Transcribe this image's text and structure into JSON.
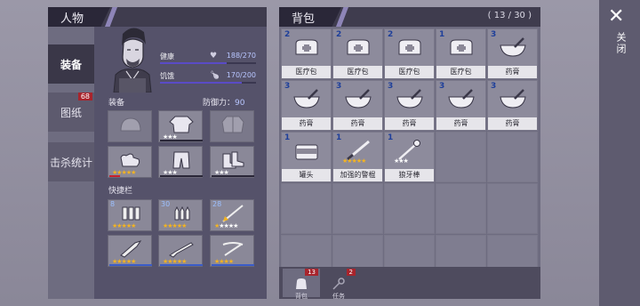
{
  "character_panel": {
    "title": "人物",
    "tabs": [
      {
        "label": "装备",
        "active": true
      },
      {
        "label": "图纸",
        "badge": "68"
      },
      {
        "label": "击杀统计"
      }
    ],
    "stats": {
      "health": {
        "label": "健康",
        "value": "188/270",
        "fraction": 0.696
      },
      "hunger": {
        "label": "饥饿",
        "value": "170/200",
        "fraction": 0.85
      }
    },
    "equipment_label": "装备",
    "defense_label": "防御力：",
    "defense_value": "90",
    "quickbar_label": "快捷栏",
    "equipment": [
      {
        "name": "helmet",
        "stars": 0
      },
      {
        "name": "shirt",
        "stars": 3
      },
      {
        "name": "jacket",
        "stars": 0
      },
      {
        "name": "gloves",
        "stars": 5
      },
      {
        "name": "pants",
        "stars": 3
      },
      {
        "name": "boots",
        "stars": 3
      }
    ],
    "quickbar": [
      {
        "name": "shells",
        "qty": "8",
        "stars": 5
      },
      {
        "name": "bullets",
        "qty": "30",
        "stars": 5
      },
      {
        "name": "arrows",
        "qty": "28",
        "stars": 5
      },
      {
        "name": "knife",
        "stars": 5
      },
      {
        "name": "rifle",
        "stars": 5
      },
      {
        "name": "crossbow",
        "stars": 4
      }
    ]
  },
  "backpack": {
    "title": "背包",
    "count": "( 13 / 30 )",
    "items": [
      {
        "count": "2",
        "label": "医疗包",
        "icon": "medkit"
      },
      {
        "count": "2",
        "label": "医疗包",
        "icon": "medkit"
      },
      {
        "count": "2",
        "label": "医疗包",
        "icon": "medkit"
      },
      {
        "count": "1",
        "label": "医疗包",
        "icon": "medkit"
      },
      {
        "count": "3",
        "label": "药膏",
        "icon": "mortar"
      },
      {
        "count": "3",
        "label": "药膏",
        "icon": "mortar"
      },
      {
        "count": "3",
        "label": "药膏",
        "icon": "mortar"
      },
      {
        "count": "3",
        "label": "药膏",
        "icon": "mortar"
      },
      {
        "count": "3",
        "label": "药膏",
        "icon": "mortar"
      },
      {
        "count": "3",
        "label": "药膏",
        "icon": "mortar"
      },
      {
        "count": "1",
        "label": "罐头",
        "icon": "can"
      },
      {
        "count": "1",
        "label": "加强的警棍",
        "icon": "baton",
        "stars": 5
      },
      {
        "count": "1",
        "label": "狼牙棒",
        "icon": "mace",
        "stars": 3
      }
    ],
    "footer_tabs": [
      {
        "label": "背包",
        "badge": "13",
        "active": true
      },
      {
        "label": "任务",
        "badge": "2"
      }
    ]
  },
  "close_label": "关闭",
  "close_glyph": "✕"
}
